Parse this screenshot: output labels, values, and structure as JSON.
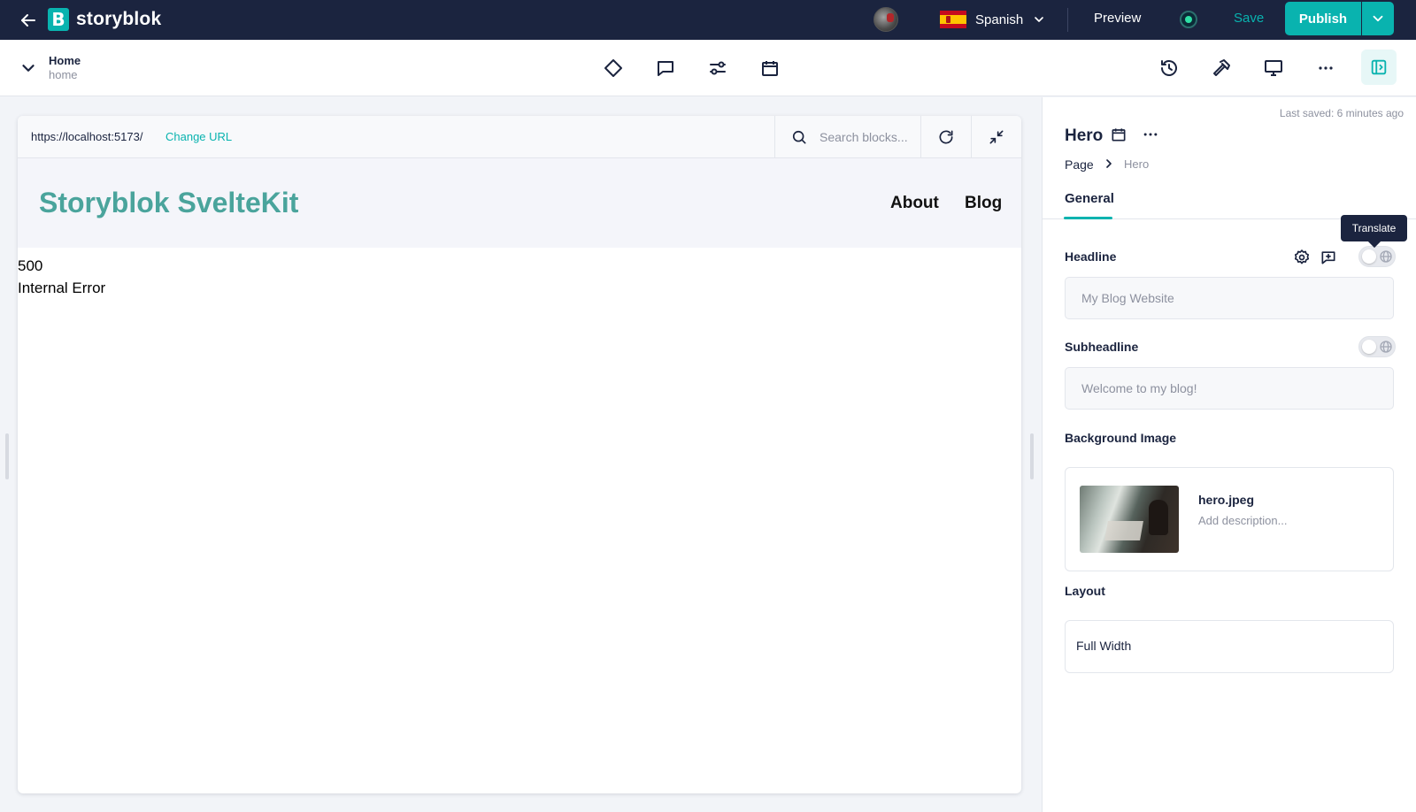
{
  "topbar": {
    "brand": "storyblok",
    "brand_mark": "B",
    "language": "Spanish",
    "preview_label": "Preview",
    "save_label": "Save",
    "publish_label": "Publish"
  },
  "story": {
    "title": "Home",
    "slug": "home"
  },
  "toolbar_icons": [
    "diamond-icon",
    "comment-icon",
    "sliders-icon",
    "calendar-icon"
  ],
  "right_toolbar_icons": [
    "history-icon",
    "hammer-icon",
    "monitor-icon",
    "more-icon",
    "panel-toggle-icon"
  ],
  "preview": {
    "url": "https://localhost:5173/",
    "change_url_label": "Change URL",
    "search_placeholder": "Search blocks...",
    "site_title": "Storyblok SvelteKit",
    "nav": [
      "About",
      "Blog"
    ],
    "error_code": "500",
    "error_message": "Internal Error"
  },
  "panel": {
    "last_saved": "Last saved: 6 minutes ago",
    "block_title": "Hero",
    "breadcrumb": [
      "Page",
      "Hero"
    ],
    "tab_general": "General",
    "tooltip": "Translate",
    "fields": {
      "headline": {
        "label": "Headline",
        "placeholder": "My Blog Website"
      },
      "subheadline": {
        "label": "Subheadline",
        "placeholder": "Welcome to my blog!"
      },
      "background_image": {
        "label": "Background Image",
        "file_name": "hero.jpeg",
        "description_placeholder": "Add description..."
      },
      "layout": {
        "label": "Layout",
        "value": "Full Width"
      }
    }
  },
  "colors": {
    "brand_teal": "#09b3af",
    "topbar_bg": "#1b243f",
    "site_title": "#4aa49c"
  }
}
